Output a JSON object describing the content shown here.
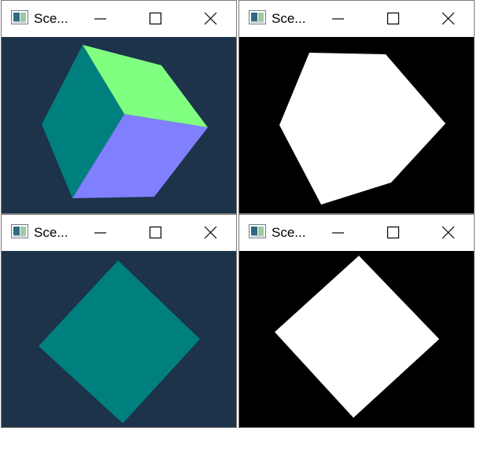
{
  "windows": [
    {
      "title": "Sce...",
      "canvas_type": "color-render",
      "background": "#1c334a",
      "faces": [
        {
          "name": "cube-face-left",
          "color": "#007f7f"
        },
        {
          "name": "cube-face-top",
          "color": "#80ff80"
        },
        {
          "name": "cube-face-front",
          "color": "#8080ff"
        }
      ]
    },
    {
      "title": "Sce...",
      "canvas_type": "mask",
      "background": "#000000",
      "foreground": "#ffffff"
    },
    {
      "title": "Sce...",
      "canvas_type": "color-render",
      "background": "#1c334a",
      "faces": [
        {
          "name": "cube-face-front",
          "color": "#007f7f"
        }
      ]
    },
    {
      "title": "Sce...",
      "canvas_type": "mask",
      "background": "#000000",
      "foreground": "#ffffff"
    }
  ],
  "window_controls": {
    "minimize": "minimize-icon",
    "maximize": "maximize-icon",
    "close": "close-icon"
  },
  "app_icon": "window-app-icon"
}
